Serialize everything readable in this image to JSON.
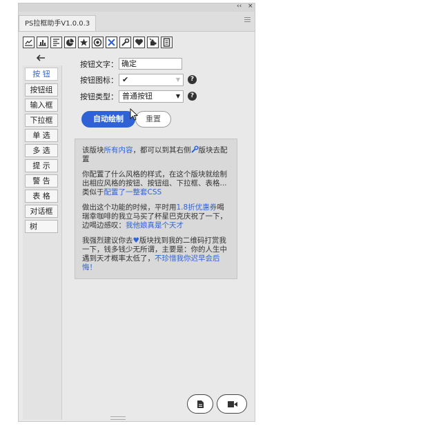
{
  "panel": {
    "collapse_glyph": "‹‹",
    "close_glyph": "×",
    "tab_title": "PS拉框助手V1.0.0.3"
  },
  "toolbar": {
    "icons": [
      "line-chart-icon",
      "bar-chart-icon",
      "list-icon",
      "pie-chart-icon",
      "star-icon",
      "globe-icon",
      "magic-tools-icon",
      "wrench-icon",
      "heart-icon",
      "puzzle-icon",
      "document-icon"
    ],
    "active_index": 6
  },
  "sidebar": {
    "back_glyph": "←",
    "items": [
      {
        "label": "按  钮",
        "active": true
      },
      {
        "label": "按钮组"
      },
      {
        "label": "输入框"
      },
      {
        "label": "下拉框"
      },
      {
        "label": "单  选"
      },
      {
        "label": "多  选"
      },
      {
        "label": "提  示"
      },
      {
        "label": "警  告"
      },
      {
        "label": "表  格"
      },
      {
        "label": "对话框"
      },
      {
        "label": "树"
      }
    ]
  },
  "form": {
    "text_label": "按钮文字：",
    "text_value": "确定",
    "icon_label": "按钮图标：",
    "icon_value": "✔",
    "type_label": "按钮类型：",
    "type_value": "普通按钮",
    "help_glyph": "?"
  },
  "actions": {
    "draw_label": "自动绘制",
    "reset_label": "重置"
  },
  "info": {
    "p1_a": "该版块",
    "p1_link": "所有内容",
    "p1_b": "，都可以到其右侧",
    "p1_c": "版块去配置",
    "p2_a": "你配置了什么风格的样式，在这个版块就绘制出相应风格的按钮、按钮组、下拉框、表格...类似于",
    "p2_link": "配置了一整套CSS",
    "p3_a": "做出这个功能的时候，平时用",
    "p3_link1": "1.8折优惠券",
    "p3_b": "喝瑞幸咖啡的我立马买了杯星巴克庆祝了一下，边喝边感叹：",
    "p3_link2": "我他娘真是个天才",
    "p4_a": "我强烈建议你去",
    "p4_heart": "♥",
    "p4_b": "版块找到我的二维码打赏我一下，钱多钱少无所谓，主要是：你的人生中遇到天才概率太低了，",
    "p4_link": "不珍惜我你迟早会后悔！"
  },
  "bottom": {
    "left_icon": "file-icon",
    "right_icon": "video-icon"
  }
}
